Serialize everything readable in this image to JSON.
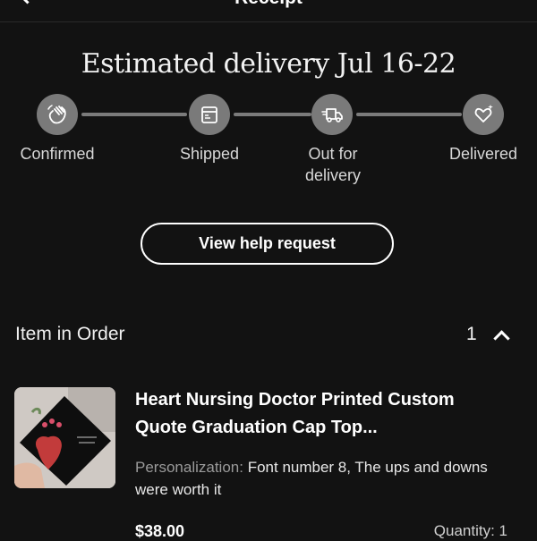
{
  "header": {
    "title": "Receipt"
  },
  "estimated_delivery": "Estimated delivery Jul 16-22",
  "steps": [
    {
      "label": "Confirmed",
      "icon": "waving-hand-icon"
    },
    {
      "label": "Shipped",
      "icon": "package-icon"
    },
    {
      "label": "Out for delivery",
      "icon": "delivery-truck-icon"
    },
    {
      "label": "Delivered",
      "icon": "heart-sparkle-icon"
    }
  ],
  "help_button": "View help request",
  "order_section": {
    "title": "Item in Order",
    "count": "1"
  },
  "item": {
    "title": "Heart Nursing Doctor Printed Custom Quote Graduation Cap Top...",
    "personalization_label": "Personalization:",
    "personalization_value": "Font number 8, The ups and downs were worth it",
    "price": "$38.00",
    "quantity": "Quantity: 1"
  },
  "colors": {
    "background": "#121212",
    "step_circle": "#7a7a7a",
    "track_line": "#7b7b7b",
    "text": "#ffffff",
    "muted_text": "#9a9a9a"
  }
}
